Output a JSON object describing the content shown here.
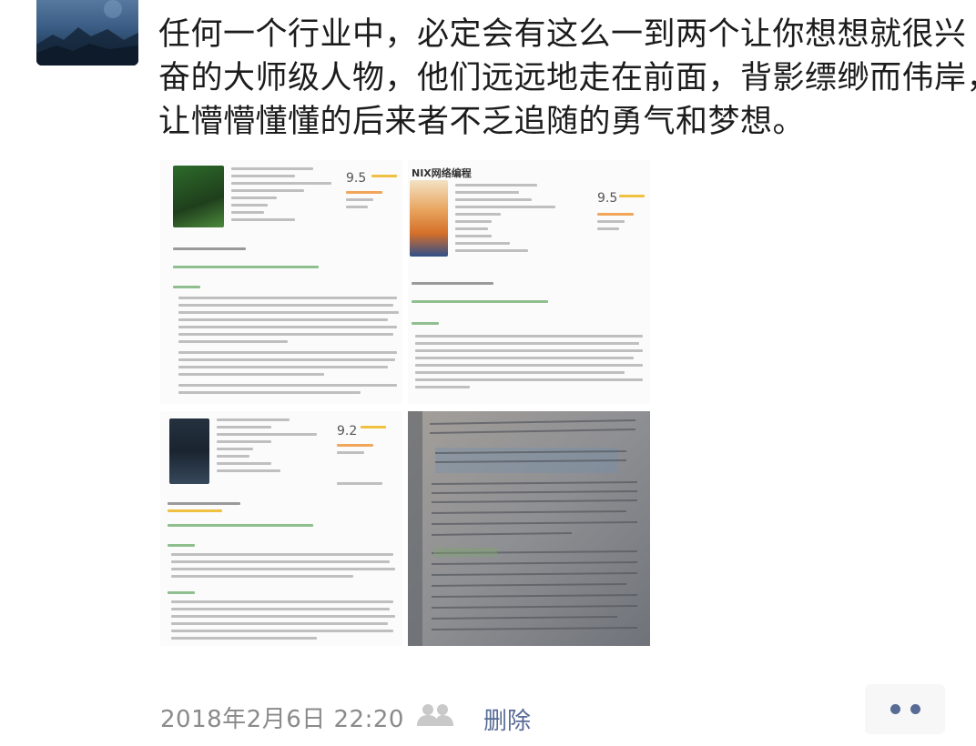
{
  "post": {
    "text_lines": [
      "任何一个行业中，必定会有这么一到两个让你想想就很兴",
      "奋的大师级人物，他们远远地走在前面，背影缥缈而伟岸，",
      "让懵懵懂懂的后来者不乏追随的勇气和梦想。"
    ]
  },
  "images": {
    "book1": {
      "score": "9.5"
    },
    "book2": {
      "title": "NIX网络编程",
      "score": "9.5"
    },
    "book3": {
      "score": "9.2"
    }
  },
  "footer": {
    "timestamp": "2018年2月6日 22:20",
    "delete_label": "删除",
    "friends_icon": "friends-icon",
    "more_icon": "more-dots-icon"
  },
  "colors": {
    "link": "#576b95",
    "meta_text": "#8a8a8a",
    "body_text": "#1c1c1c"
  }
}
